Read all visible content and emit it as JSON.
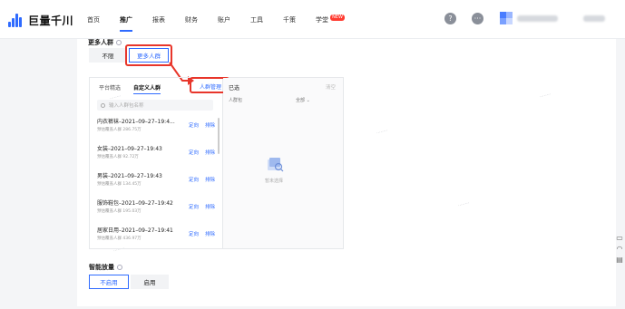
{
  "brand": {
    "name": "巨量千川",
    "color": "#2f6bff"
  },
  "nav": {
    "items": [
      "首页",
      "推广",
      "报表",
      "财务",
      "账户",
      "工具",
      "千策",
      "学堂"
    ],
    "active": "推广",
    "new_badge": "NEW"
  },
  "header_right": {
    "help_icon": "question-icon",
    "more_icon": "more-icon"
  },
  "more_audience": {
    "label": "更多人群",
    "options": [
      "不限",
      "更多人群"
    ],
    "selected": "更多人群"
  },
  "panel": {
    "tabs": [
      "平台精选",
      "自定义人群"
    ],
    "active_tab": "自定义人群",
    "manage_link": "人群管理",
    "search_placeholder": "输入人群包名称",
    "packages": [
      {
        "name": "内衣裤袜–2021–09–27–19:4...",
        "sub": "预估覆盖人群 286.75万",
        "action1": "定向",
        "action2": "排除"
      },
      {
        "name": "女装–2021–09–27–19:43",
        "sub": "预估覆盖人群 92.72万",
        "action1": "定向",
        "action2": "排除"
      },
      {
        "name": "男装–2021–09–27–19:43",
        "sub": "预估覆盖人群 134.45万",
        "action1": "定向",
        "action2": "排除"
      },
      {
        "name": "服饰鞋包–2021–09–27–19:42",
        "sub": "预估覆盖人群 195.03万",
        "action1": "定向",
        "action2": "排除"
      },
      {
        "name": "居家日用–2021–09–27–19:41",
        "sub": "预估覆盖人群 436.97万",
        "action1": "定向",
        "action2": "排除"
      }
    ],
    "selected_title": "已选",
    "clear_label": "清空",
    "col_package": "人群包",
    "col_filter": "全部 ⌄",
    "empty_text": "暂未选择"
  },
  "smart_release": {
    "label": "智能放量",
    "options": [
      "不启用",
      "启用"
    ],
    "selected": "不启用"
  },
  "colors": {
    "accent": "#2f6bff",
    "highlight": "#e8362b",
    "new_badge": "#ff3b30"
  }
}
